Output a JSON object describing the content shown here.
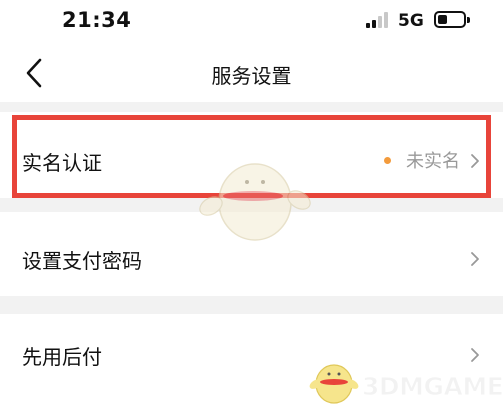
{
  "status_bar": {
    "time": "21:34",
    "network": "5G"
  },
  "nav": {
    "title": "服务设置"
  },
  "rows": [
    {
      "label": "实名认证",
      "status": "未实名"
    },
    {
      "label": "设置支付密码"
    },
    {
      "label": "先用后付"
    }
  ],
  "watermark": {
    "text": "3DMGAME"
  },
  "colors": {
    "highlight": "#e8443a",
    "status_dot": "#f39b3c",
    "background": "#f2f2f2"
  }
}
